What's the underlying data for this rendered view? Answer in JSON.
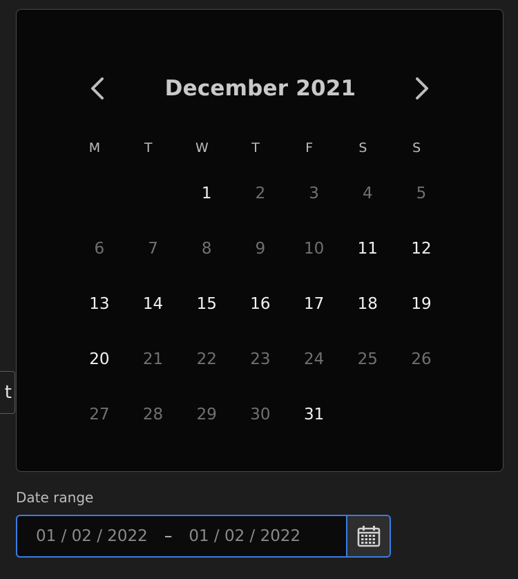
{
  "edge_button": {
    "label": "t"
  },
  "calendar": {
    "month_title": "December 2021",
    "weekdays": [
      "M",
      "T",
      "W",
      "T",
      "F",
      "S",
      "S"
    ],
    "weeks": [
      [
        {
          "d": "",
          "active": false
        },
        {
          "d": "",
          "active": false
        },
        {
          "d": "1",
          "active": true
        },
        {
          "d": "2",
          "active": false
        },
        {
          "d": "3",
          "active": false
        },
        {
          "d": "4",
          "active": false
        },
        {
          "d": "5",
          "active": false
        }
      ],
      [
        {
          "d": "6",
          "active": false
        },
        {
          "d": "7",
          "active": false
        },
        {
          "d": "8",
          "active": false
        },
        {
          "d": "9",
          "active": false
        },
        {
          "d": "10",
          "active": false
        },
        {
          "d": "11",
          "active": true
        },
        {
          "d": "12",
          "active": true
        }
      ],
      [
        {
          "d": "13",
          "active": true
        },
        {
          "d": "14",
          "active": true
        },
        {
          "d": "15",
          "active": true
        },
        {
          "d": "16",
          "active": true
        },
        {
          "d": "17",
          "active": true
        },
        {
          "d": "18",
          "active": true
        },
        {
          "d": "19",
          "active": true
        }
      ],
      [
        {
          "d": "20",
          "active": true
        },
        {
          "d": "21",
          "active": false
        },
        {
          "d": "22",
          "active": false
        },
        {
          "d": "23",
          "active": false
        },
        {
          "d": "24",
          "active": false
        },
        {
          "d": "25",
          "active": false
        },
        {
          "d": "26",
          "active": false
        }
      ],
      [
        {
          "d": "27",
          "active": false
        },
        {
          "d": "28",
          "active": false
        },
        {
          "d": "29",
          "active": false
        },
        {
          "d": "30",
          "active": false
        },
        {
          "d": "31",
          "active": true
        },
        {
          "d": "",
          "active": false
        },
        {
          "d": "",
          "active": false
        }
      ]
    ],
    "prev_icon": "chevron-left-icon",
    "next_icon": "chevron-right-icon"
  },
  "date_range": {
    "label": "Date range",
    "start": "01 / 02 / 2022",
    "separator": "–",
    "end": "01 / 02 / 2022",
    "button_icon": "calendar-icon"
  },
  "colors": {
    "background": "#1d1d1d",
    "popover": "#080808",
    "focus_accent": "#3b7ce6"
  }
}
